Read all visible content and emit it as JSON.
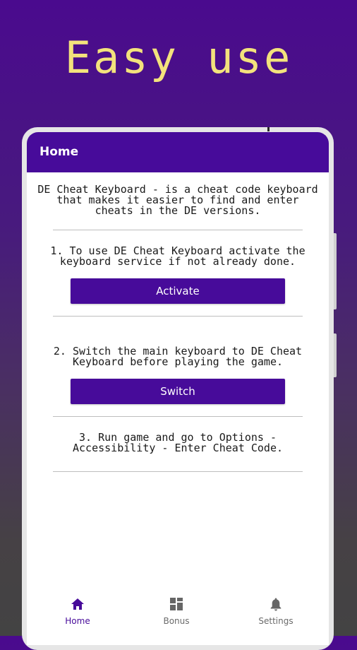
{
  "promo": {
    "headline": "Easy use"
  },
  "app": {
    "title": "Home",
    "intro": "DE Cheat Keyboard - is a cheat code keyboard that makes it easier to find and enter cheats in the DE versions.",
    "steps": [
      {
        "text": "1. To use DE Cheat Keyboard activate the keyboard service if not already done.",
        "button": "Activate"
      },
      {
        "text": "2. Switch the main keyboard to DE Cheat Keyboard before playing the game.",
        "button": "Switch"
      },
      {
        "text": "3. Run game and go to Options - Accessibility - Enter Cheat Code."
      }
    ]
  },
  "bottom_nav": {
    "items": [
      {
        "label": "Home",
        "icon": "home-icon",
        "active": true
      },
      {
        "label": "Bonus",
        "icon": "grid-icon",
        "active": false
      },
      {
        "label": "Settings",
        "icon": "bell-icon",
        "active": false
      }
    ]
  },
  "colors": {
    "primary": "#470b9a",
    "headline": "#f3e27c",
    "background_top": "#4a0a8e",
    "background_bottom": "#434343"
  }
}
